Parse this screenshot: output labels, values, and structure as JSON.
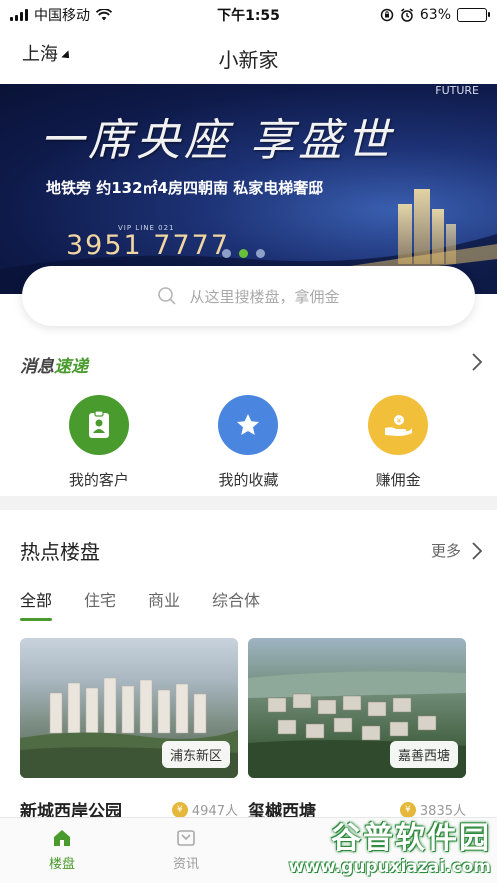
{
  "status_bar": {
    "carrier": "中国移动",
    "time": "下午1:55",
    "battery_percent": "63%",
    "battery_level": 0.63,
    "battery_color": "#f5c518"
  },
  "nav": {
    "city": "上海",
    "title": "小新家"
  },
  "banner": {
    "slogan": "一席央座 享盛世",
    "subtitle": "地铁旁 约132㎡4房四朝南 私家电梯奢邸",
    "vip_line": "VIP LINE 021",
    "phone": "3951 7777",
    "brand_line": "FUTURE",
    "active_dot": 1,
    "dot_count": 3
  },
  "search": {
    "placeholder": "从这里搜楼盘，拿佣金"
  },
  "news": {
    "logo_part1": "消息",
    "logo_part2": "速递"
  },
  "shortcuts": [
    {
      "label": "我的客户",
      "icon": "client-card-icon",
      "color": "#4a9b2e"
    },
    {
      "label": "我的收藏",
      "icon": "star-icon",
      "color": "#4a86e0"
    },
    {
      "label": "赚佣金",
      "icon": "coin-hand-icon",
      "color": "#f2bf3a"
    }
  ],
  "hot": {
    "title": "热点楼盘",
    "more": "更多",
    "tabs": [
      "全部",
      "住宅",
      "商业",
      "综合体"
    ],
    "active_tab": 0,
    "cards": [
      {
        "area": "浦东新区",
        "name": "新城西岸公园",
        "count": "4947人"
      },
      {
        "area": "嘉善西塘",
        "name": "玺樾西塘",
        "count": "3835人"
      }
    ]
  },
  "tabbar": {
    "items": [
      {
        "label": "楼盘",
        "icon": "building-icon",
        "active": true
      },
      {
        "label": "资讯",
        "icon": "news-icon",
        "active": false
      }
    ],
    "accent": "#4a9b2e"
  },
  "watermark": {
    "main": "谷普软件园",
    "url": "www.gupuxiazai.com"
  }
}
